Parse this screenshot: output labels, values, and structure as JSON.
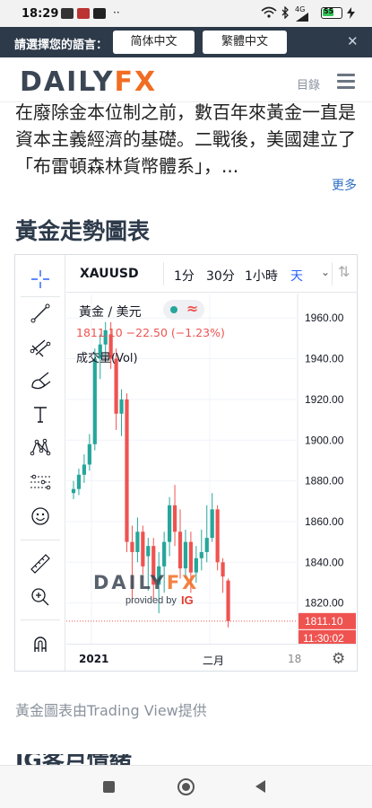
{
  "status_bar": {
    "time": "18:29",
    "extra": "··",
    "network": "4G",
    "battery": "55"
  },
  "language_bar": {
    "prompt": "請選擇您的語言：",
    "options": [
      "简体中文",
      "繁體中文"
    ],
    "close": "✕"
  },
  "header": {
    "logo_daily": "DAILY",
    "logo_fx": "FX",
    "toc": "目錄"
  },
  "article": {
    "intro": "在廢除金本位制之前，數百年來黃金一直是資本主義經濟的基礎。二戰後，美國建立了「布雷頓森林貨幣體系」，...",
    "more": "更多",
    "section_title": "黃金走勢圖表",
    "caption": "黃金圖表由Trading View提供",
    "next_heading": "IG客戶情緒"
  },
  "chart_widget": {
    "symbol": "XAUUSD",
    "timeframes": [
      "1分",
      "30分",
      "1小時",
      "天"
    ],
    "active_timeframe": "天",
    "legend_title": "黃金 / 美元",
    "legend_quote": "1811.10  −22.50 (−1.23%)",
    "legend_vol": "成交量(Vol)",
    "watermark_daily": "DAILY",
    "watermark_fx": "FX",
    "watermark_sub": "provided by",
    "watermark_brand": "IG",
    "last_price_label": "1811.10",
    "countdown_label": "11:30:02",
    "x_year": "2021",
    "x_month": "二月",
    "x_next": "18"
  },
  "colors": {
    "up": "#26a69a",
    "down": "#ef5350",
    "brand_orange": "#f16d22",
    "brand_dark": "#3b4654"
  },
  "chart_data": {
    "type": "candlestick",
    "title": "黃金 / 美元",
    "y_ticks": [
      1960,
      1940,
      1920,
      1900,
      1880,
      1860,
      1840,
      1820
    ],
    "ylim": [
      1800,
      1972
    ],
    "last_price": 1811.1,
    "change": -22.5,
    "change_pct": -1.23,
    "x_labels": [
      "2021",
      "二月",
      "18"
    ],
    "candles": [
      {
        "o": 1874,
        "h": 1880,
        "l": 1871,
        "c": 1876
      },
      {
        "o": 1876,
        "h": 1886,
        "l": 1873,
        "c": 1883
      },
      {
        "o": 1883,
        "h": 1893,
        "l": 1879,
        "c": 1888
      },
      {
        "o": 1888,
        "h": 1903,
        "l": 1885,
        "c": 1898
      },
      {
        "o": 1898,
        "h": 1945,
        "l": 1895,
        "c": 1940
      },
      {
        "o": 1940,
        "h": 1952,
        "l": 1930,
        "c": 1947
      },
      {
        "o": 1947,
        "h": 1958,
        "l": 1940,
        "c": 1954
      },
      {
        "o": 1952,
        "h": 1958,
        "l": 1935,
        "c": 1940
      },
      {
        "o": 1940,
        "h": 1945,
        "l": 1905,
        "c": 1913
      },
      {
        "o": 1913,
        "h": 1925,
        "l": 1902,
        "c": 1920
      },
      {
        "o": 1920,
        "h": 1923,
        "l": 1845,
        "c": 1850
      },
      {
        "o": 1850,
        "h": 1858,
        "l": 1820,
        "c": 1845
      },
      {
        "o": 1845,
        "h": 1862,
        "l": 1840,
        "c": 1855
      },
      {
        "o": 1855,
        "h": 1858,
        "l": 1834,
        "c": 1838
      },
      {
        "o": 1843,
        "h": 1852,
        "l": 1826,
        "c": 1848
      },
      {
        "o": 1848,
        "h": 1852,
        "l": 1822,
        "c": 1829
      },
      {
        "o": 1829,
        "h": 1845,
        "l": 1815,
        "c": 1838
      },
      {
        "o": 1838,
        "h": 1855,
        "l": 1825,
        "c": 1850
      },
      {
        "o": 1850,
        "h": 1872,
        "l": 1843,
        "c": 1868
      },
      {
        "o": 1868,
        "h": 1878,
        "l": 1848,
        "c": 1855
      },
      {
        "o": 1855,
        "h": 1866,
        "l": 1832,
        "c": 1837
      },
      {
        "o": 1837,
        "h": 1856,
        "l": 1832,
        "c": 1850
      },
      {
        "o": 1850,
        "h": 1855,
        "l": 1825,
        "c": 1835
      },
      {
        "o": 1835,
        "h": 1848,
        "l": 1830,
        "c": 1842
      },
      {
        "o": 1842,
        "h": 1856,
        "l": 1836,
        "c": 1845
      },
      {
        "o": 1845,
        "h": 1868,
        "l": 1840,
        "c": 1852
      },
      {
        "o": 1852,
        "h": 1874,
        "l": 1850,
        "c": 1866
      },
      {
        "o": 1866,
        "h": 1868,
        "l": 1836,
        "c": 1840
      },
      {
        "o": 1840,
        "h": 1842,
        "l": 1825,
        "c": 1833
      },
      {
        "o": 1831,
        "h": 1832,
        "l": 1808,
        "c": 1811.1
      }
    ]
  }
}
